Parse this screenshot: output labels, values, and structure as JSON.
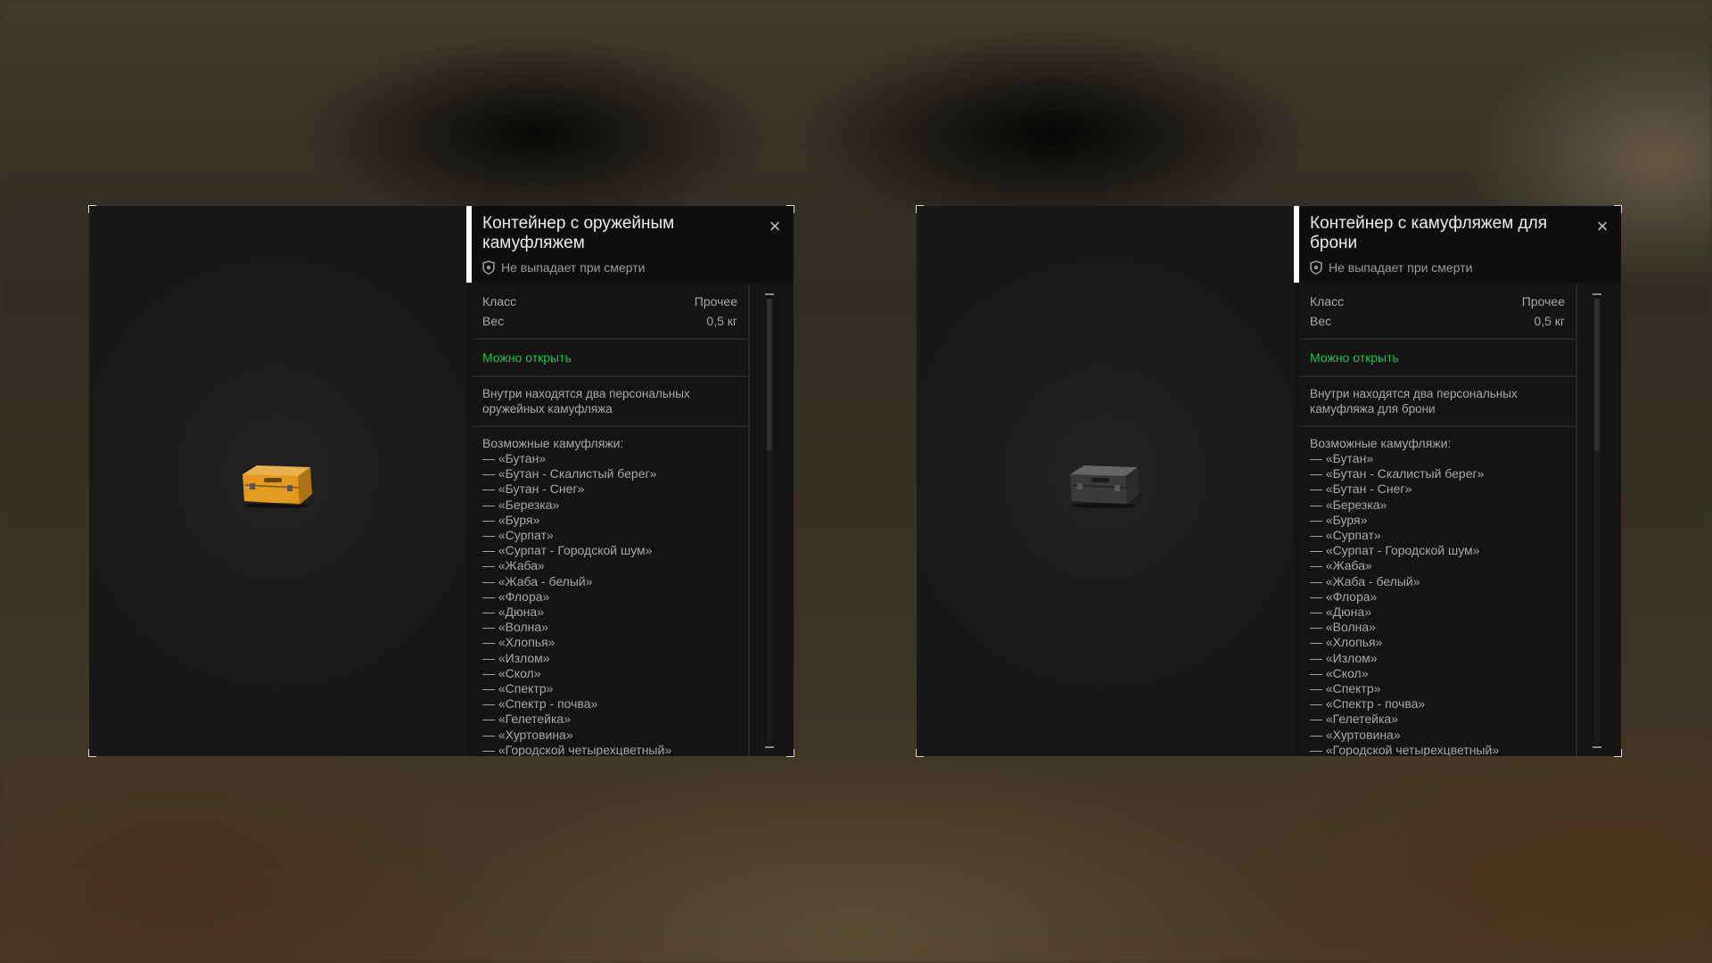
{
  "panels": [
    {
      "title": "Контейнер с оружейным камуфляжем",
      "no_drop": "Не выпадает при смерти",
      "close_icon": "close-icon",
      "stats": [
        {
          "label": "Класс",
          "value": "Прочее"
        },
        {
          "label": "Вес",
          "value": "0,5 кг"
        }
      ],
      "openable": "Можно открыть",
      "description": "Внутри находятся два персональных оружейных камуфляжа",
      "case_color": "#e39a1e",
      "camo_title": "Возможные камуфляжи:",
      "camos": [
        "— «Бутан»",
        "— «Бутан - Скалистый берег»",
        "— «Бутан - Снег»",
        "— «Березка»",
        "— «Буря»",
        "— «Сурпат»",
        "— «Сурпат - Городской шум»",
        "— «Жаба»",
        "— «Жаба - белый»",
        "— «Флора»",
        "— «Дюна»",
        "— «Волна»",
        "— «Хлопья»",
        "— «Излом»",
        "— «Скол»",
        "— «Спектр»",
        "— «Спектр - почва»",
        "— «Гелетейка»",
        "— «Хуртовина»",
        "— «Городской четырехцветный»"
      ]
    },
    {
      "title": "Контейнер с камуфляжем для брони",
      "no_drop": "Не выпадает при смерти",
      "close_icon": "close-icon",
      "stats": [
        {
          "label": "Класс",
          "value": "Прочее"
        },
        {
          "label": "Вес",
          "value": "0,5 кг"
        }
      ],
      "openable": "Можно открыть",
      "description": "Внутри находятся два персональных камуфляжа для брони",
      "case_color": "#3a3a3a",
      "camo_title": "Возможные камуфляжи:",
      "camos": [
        "— «Бутан»",
        "— «Бутан - Скалистый берег»",
        "— «Бутан - Снег»",
        "— «Березка»",
        "— «Буря»",
        "— «Сурпат»",
        "— «Сурпат - Городской шум»",
        "— «Жаба»",
        "— «Жаба - белый»",
        "— «Флора»",
        "— «Дюна»",
        "— «Волна»",
        "— «Хлопья»",
        "— «Излом»",
        "— «Скол»",
        "— «Спектр»",
        "— «Спектр - почва»",
        "— «Гелетейка»",
        "— «Хуртовина»",
        "— «Городской четырехцветный»"
      ]
    }
  ],
  "colors": {
    "openable_green": "#24c24a",
    "header_accent": "#ffffff"
  }
}
